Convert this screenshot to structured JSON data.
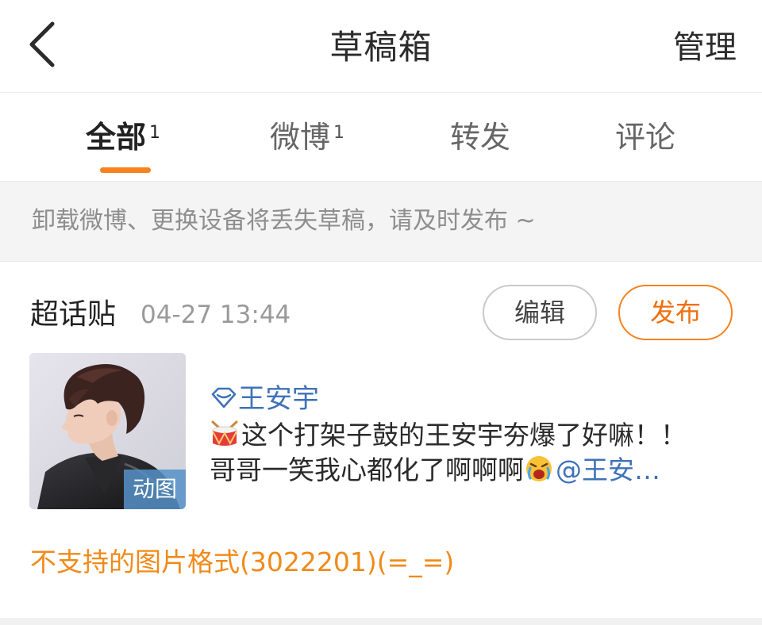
{
  "header": {
    "title": "草稿箱",
    "manage_label": "管理",
    "back_icon": "chevron-left-icon"
  },
  "tabs": [
    {
      "label": "全部",
      "count": "1",
      "active": true
    },
    {
      "label": "微博",
      "count": "1",
      "active": false
    },
    {
      "label": "转发",
      "count": "",
      "active": false
    },
    {
      "label": "评论",
      "count": "",
      "active": false
    }
  ],
  "notice": {
    "text": "卸载微博、更换设备将丢失草稿，请及时发布 ~"
  },
  "draft": {
    "type_label": "超话贴",
    "timestamp": "04-27 13:44",
    "edit_label": "编辑",
    "publish_label": "发布",
    "thumbnail_badge": "动图",
    "topic_icon": "diamond-icon",
    "topic_name": "王安宇",
    "line1_emoji": "drum-emoji",
    "line1_text": "这个打架子鼓的王安宇夯爆了好嘛！！",
    "line2_text": "哥哥一笑我心都化了啊啊啊",
    "line2_emoji": "crying-face-emoji",
    "mention_text": "@王安…",
    "error_text": "不支持的图片格式(3022201)(=_=)"
  },
  "colors": {
    "accent": "#f7821e",
    "link": "#3f72b8",
    "error": "#f08a1a",
    "notice_bg": "#f4f4f4"
  }
}
